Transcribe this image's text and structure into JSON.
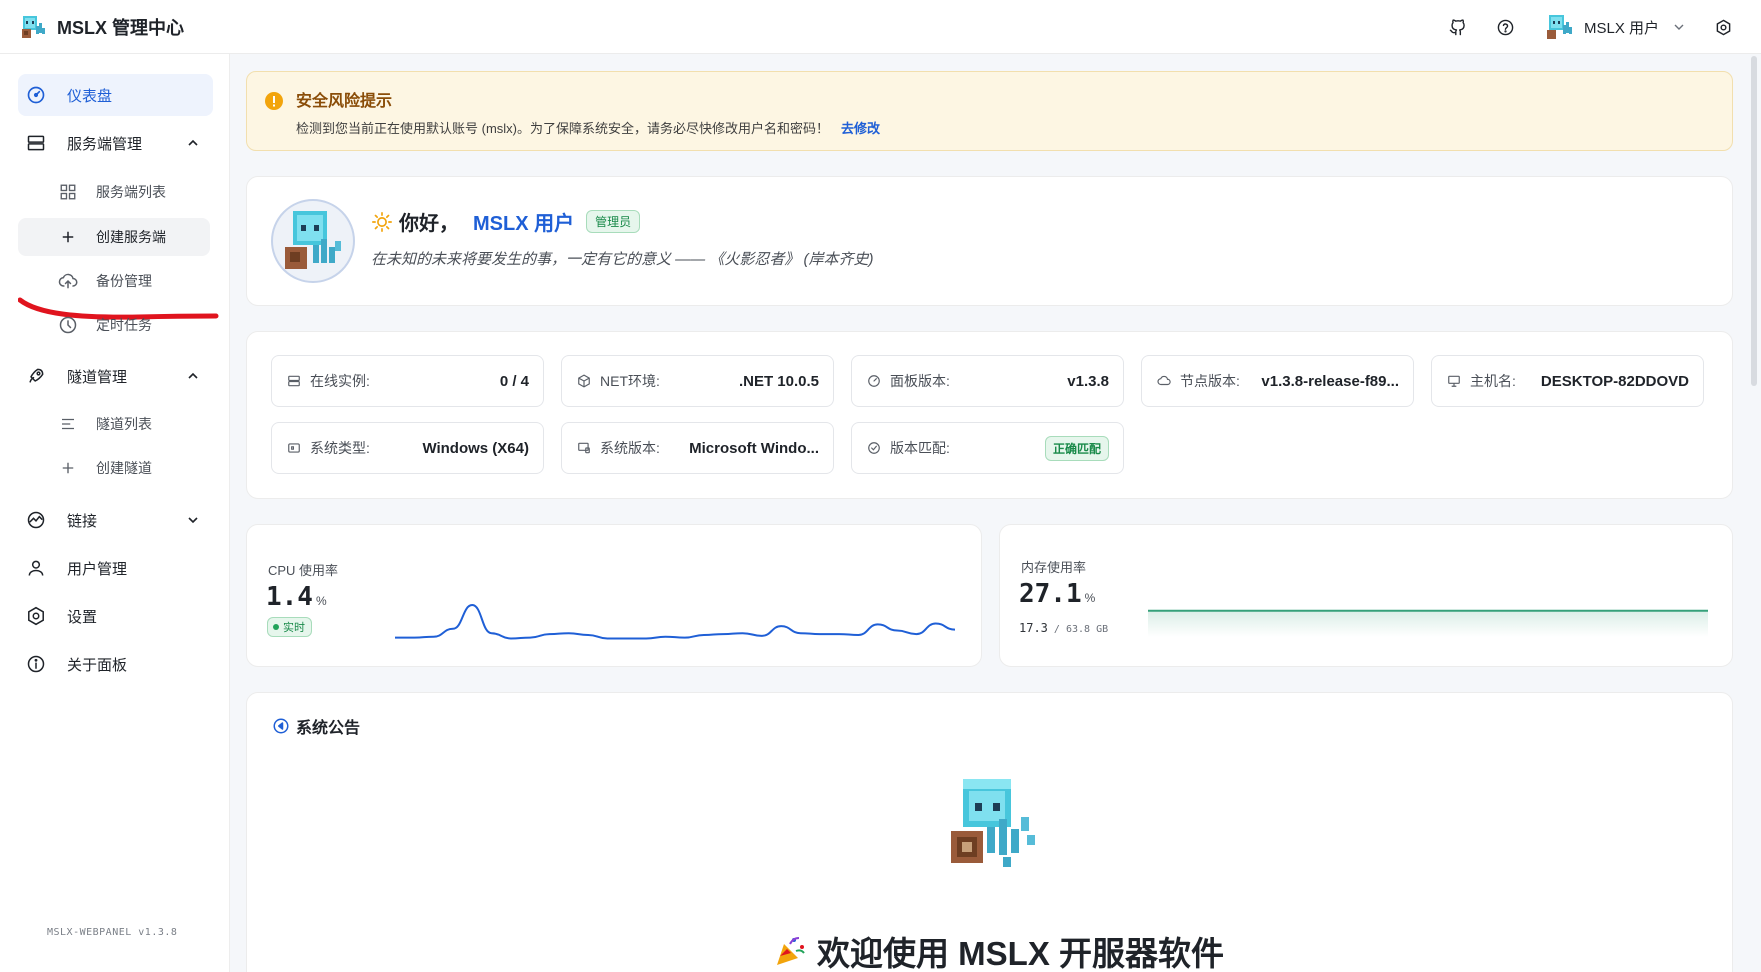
{
  "app": {
    "title": "MSLX 管理中心"
  },
  "topbar": {
    "icons": [
      "github-icon",
      "help-icon",
      "settings-icon"
    ],
    "user_name": "MSLX 用户"
  },
  "sidebar": {
    "items": [
      {
        "label": "仪表盘",
        "icon": "dashboard-icon",
        "active": true
      },
      {
        "label": "服务端管理",
        "icon": "server-icon",
        "expanded": true
      },
      {
        "label": "服务端列表",
        "icon": "grid-icon"
      },
      {
        "label": "创建服务端",
        "icon": "plus-icon"
      },
      {
        "label": "备份管理",
        "icon": "cloud-upload-icon"
      },
      {
        "label": "定时任务",
        "icon": "clock-icon"
      },
      {
        "label": "隧道管理",
        "icon": "rocket-icon",
        "expanded": true
      },
      {
        "label": "隧道列表",
        "icon": "list-icon"
      },
      {
        "label": "创建隧道",
        "icon": "plus-icon"
      },
      {
        "label": "链接",
        "icon": "link-icon",
        "expanded": false
      },
      {
        "label": "用户管理",
        "icon": "user-icon"
      },
      {
        "label": "设置",
        "icon": "gear-icon"
      },
      {
        "label": "关于面板",
        "icon": "info-icon"
      }
    ],
    "version": "MSLX-WEBPANEL v1.3.8"
  },
  "alert": {
    "title": "安全风险提示",
    "text": "检测到您当前正在使用默认账号 (mslx)。为了保障系统安全，请务必尽快修改用户名和密码！",
    "link": "去修改"
  },
  "welcome": {
    "hello": "你好，",
    "user": "MSLX 用户",
    "badge": "管理员",
    "quote": "在未知的未来将要发生的事，一定有它的意义 —— 《火影忍者》 (岸本齐史)"
  },
  "info": [
    {
      "key": "在线实例:",
      "value": "0 / 4",
      "icon": "server-icon"
    },
    {
      "key": "NET环境:",
      "value": ".NET 10.0.5",
      "icon": "cube-icon"
    },
    {
      "key": "面板版本:",
      "value": "v1.3.8",
      "icon": "gauge-icon"
    },
    {
      "key": "节点版本:",
      "value": "v1.3.8-release-f89...",
      "icon": "cloud-icon"
    },
    {
      "key": "主机名:",
      "value": "DESKTOP-82DDOVD",
      "icon": "monitor-icon"
    },
    {
      "key": "系统类型:",
      "value": "Windows (X64)",
      "icon": "chip-icon"
    },
    {
      "key": "系统版本:",
      "value": "Microsoft Windo...",
      "icon": "desktop-icon"
    },
    {
      "key": "版本匹配:",
      "value": "正确匹配",
      "icon": "check-circle-icon",
      "badge": true
    }
  ],
  "cpu": {
    "label": "CPU 使用率",
    "value": "1.4",
    "unit": "%",
    "live": "实时"
  },
  "memory": {
    "label": "内存使用率",
    "value": "27.1",
    "unit": "%",
    "used": "17.3",
    "total": "63.8 GB"
  },
  "chart_data": [
    {
      "type": "line",
      "title": "CPU 使用率",
      "values": [
        0.5,
        0.5,
        0.6,
        1.5,
        4.2,
        1.0,
        0.4,
        0.5,
        0.9,
        1.0,
        0.8,
        0.4,
        0.4,
        0.4,
        0.6,
        0.5,
        0.8,
        0.9,
        1.0,
        0.7,
        1.8,
        1.0,
        0.9,
        0.9,
        0.8,
        2.0,
        1.3,
        0.9,
        2.1,
        1.4
      ],
      "color": "#1f5fd6"
    },
    {
      "type": "area",
      "title": "内存使用率",
      "values": [
        27.1,
        27.1,
        27.1,
        27.1,
        27.1,
        27.1,
        27.1,
        27.1,
        27.1,
        27.1
      ],
      "color": "#36a17a"
    }
  ],
  "notice": {
    "title": "系统公告",
    "heading": "欢迎使用 MSLX 开服器软件"
  },
  "colors": {
    "accent": "#1f5fd6",
    "success": "#1a8a4a",
    "warning_bg": "#fdf6e3"
  }
}
